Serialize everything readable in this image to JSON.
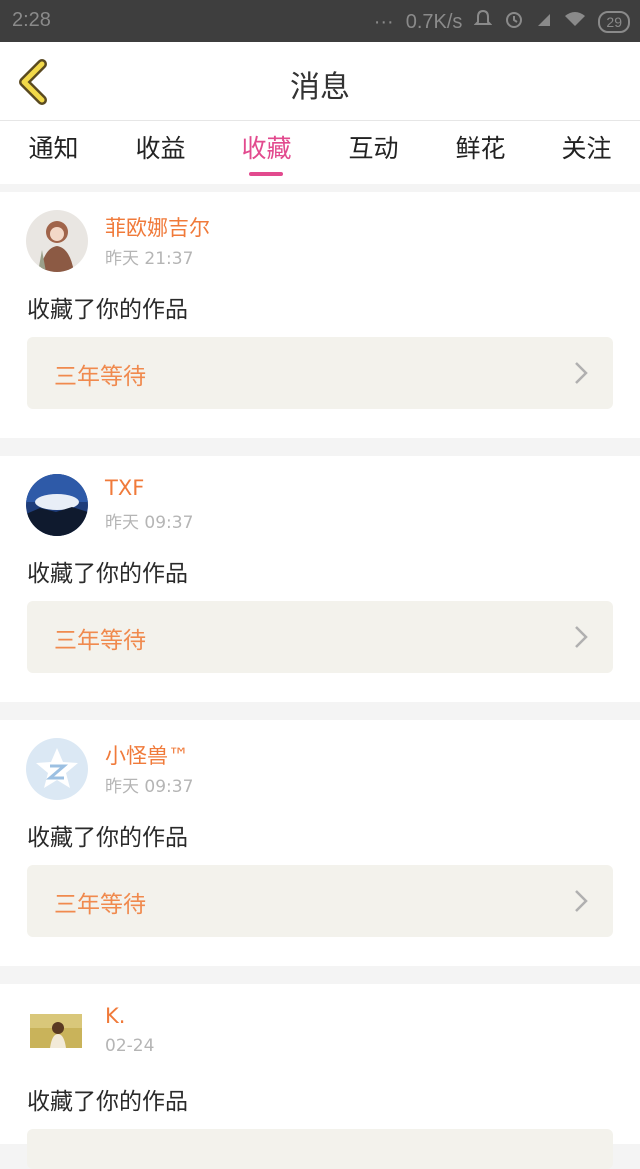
{
  "statusbar": {
    "time": "2:28",
    "network_speed": "0.7K/s",
    "battery": "29"
  },
  "header": {
    "title": "消息"
  },
  "tabs": [
    {
      "label": "通知"
    },
    {
      "label": "收益"
    },
    {
      "label": "收藏"
    },
    {
      "label": "互动"
    },
    {
      "label": "鲜花"
    },
    {
      "label": "关注"
    }
  ],
  "active_tab": "收藏",
  "colors": {
    "accent_pink": "#e24a8e",
    "username_orange": "#f07a3a",
    "work_title_orange": "#f08a4e",
    "card_bg": "#f3f2ec"
  },
  "notifications": [
    {
      "username": "菲欧娜吉尔",
      "time": "昨天 21:37",
      "action": "收藏了你的作品",
      "work_title": "三年等待",
      "avatar": "anime-girl-avatar"
    },
    {
      "username": "TXF",
      "time": "昨天 09:37",
      "action": "收藏了你的作品",
      "work_title": "三年等待",
      "avatar": "landscape-avatar"
    },
    {
      "username": "小怪兽™",
      "time": "昨天 09:37",
      "action": "收藏了你的作品",
      "work_title": "三年等待",
      "avatar": "qzone-star-avatar"
    },
    {
      "username": "K.",
      "time": "02-24",
      "action": "收藏了你的作品",
      "work_title": "",
      "avatar": "photo-avatar"
    }
  ]
}
